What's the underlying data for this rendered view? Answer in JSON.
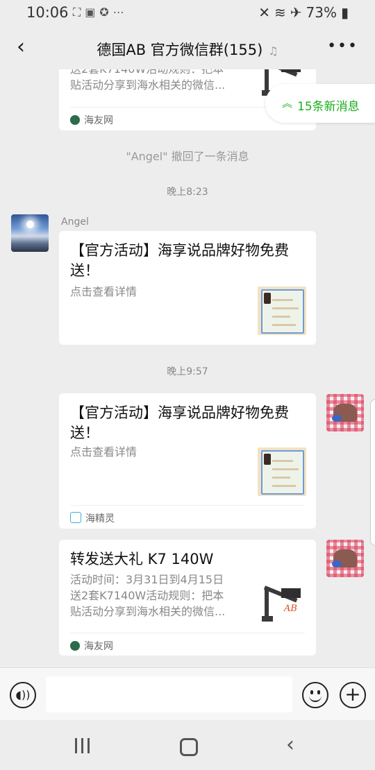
{
  "status_bar": {
    "time": "10:06",
    "notification_icons": [
      "folder-icon",
      "image-icon",
      "game-icon",
      "more-dots-icon"
    ],
    "battery_percent": "73%"
  },
  "header": {
    "back_icon": "chevron-left-icon",
    "title": "德国AB  官方微信群(155)",
    "muted_icon": "bell-off-icon",
    "more_icon": "more-horizontal-icon"
  },
  "new_messages_pill": {
    "label": "15条新消息",
    "icon": "double-chevron-up-icon",
    "color": "#1aad19"
  },
  "messages": {
    "card_partial": {
      "desc": "送2套K7140W活动规则：把本\n贴活动分享到海水相关的微信...",
      "source": "海友网"
    },
    "recall_notice": "\"Angel\" 撤回了一条消息",
    "timestamp_1": "晚上8:23",
    "angel_msg": {
      "sender": "Angel",
      "title": "【官方活动】海享说品牌好物免费送！",
      "desc": "点击查看详情"
    },
    "timestamp_2": "晚上9:57",
    "self_msg_1": {
      "title": "【官方活动】海享说品牌好物免费送！",
      "desc": "点击查看详情",
      "source": "海精灵"
    },
    "self_msg_2": {
      "title": "转发送大礼 K7 140W",
      "desc": "活动时间：3月31日到4月15日\n送2套K7140W活动规则：把本\n贴活动分享到海水相关的微信...",
      "source": "海友网",
      "thumb_brand": "AB"
    }
  },
  "input_bar": {
    "voice_icon": "voice-icon",
    "input_value": "",
    "emoji_icon": "emoji-icon",
    "plus_icon": "plus-icon"
  },
  "nav_bar": {
    "recents_icon": "recents-icon",
    "home_icon": "home-icon",
    "back_icon": "back-icon"
  },
  "colors": {
    "accent_green": "#1aad19",
    "background": "#ededed",
    "card": "#ffffff"
  }
}
